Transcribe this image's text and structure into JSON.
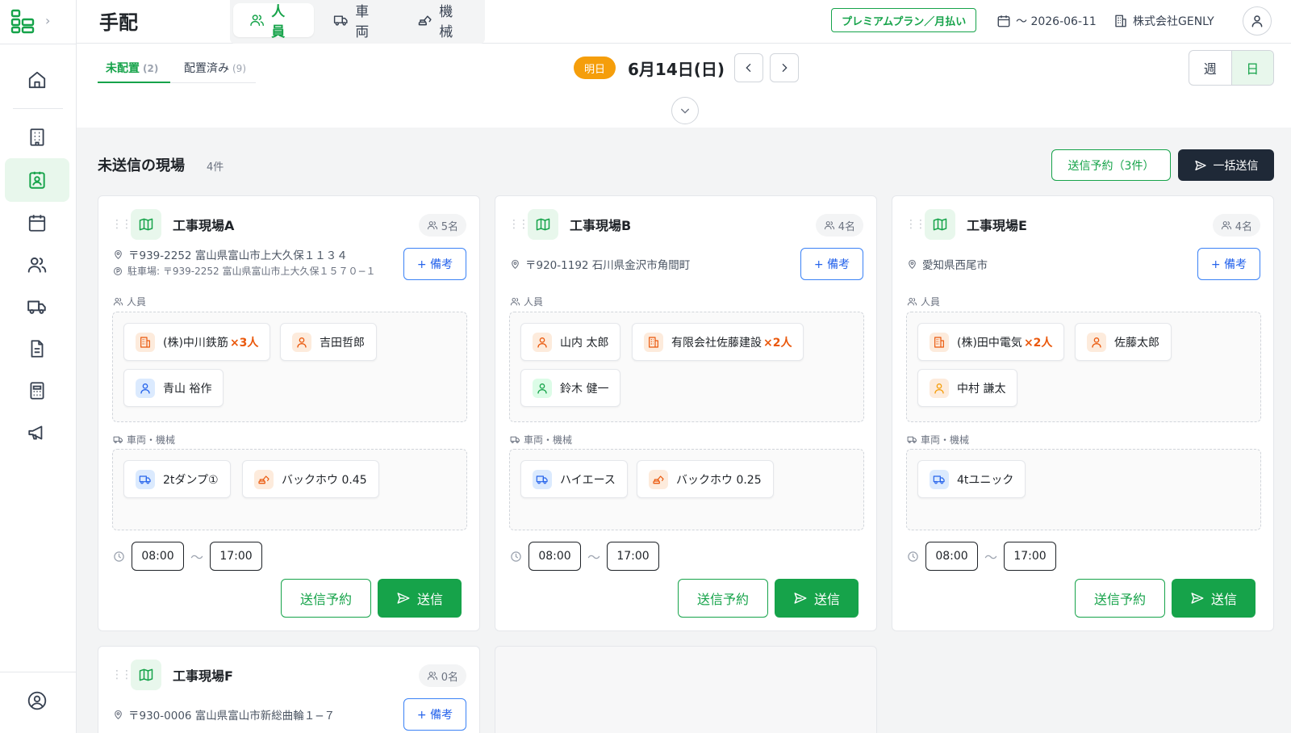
{
  "header": {
    "title": "手配",
    "tabs": [
      {
        "label": "人員"
      },
      {
        "label": "車両"
      },
      {
        "label": "機械"
      }
    ],
    "plan": "プレミアムプラン／月払い",
    "date_range": "〜 2026-06-11",
    "company": "株式会社GENLY"
  },
  "subbar": {
    "tab_unplaced": "未配置",
    "tab_unplaced_count": "(2)",
    "tab_placed": "配置済み",
    "tab_placed_count": "(9)",
    "tomorrow": "明日",
    "date": "6月14日(日)",
    "view_week": "週",
    "view_day": "日"
  },
  "section": {
    "title": "未送信の現場",
    "count": "4件",
    "schedule_all": "送信予約（3件）",
    "send_all": "一括送信"
  },
  "labels": {
    "people": "人員",
    "vehicles": "車両・機械",
    "memo": "+ 備考",
    "schedule": "送信予約",
    "send": "送信",
    "tilde": "〜"
  },
  "cards": [
    {
      "name": "工事現場A",
      "headcount": "5名",
      "address": "〒939-2252 富山県富山市上大久保１１３４",
      "parking": "駐車場: 〒939-2252 富山県富山市上大久保１５７０−１",
      "people": [
        {
          "name": "(株)中川鉄筋",
          "mult": "×3人"
        },
        {
          "name": "吉田哲郎"
        },
        {
          "name": "青山 裕作"
        }
      ],
      "vehicles": [
        {
          "name": "2tダンプ①"
        },
        {
          "name": "バックホウ 0.45"
        }
      ],
      "start": "08:00",
      "end": "17:00"
    },
    {
      "name": "工事現場B",
      "headcount": "4名",
      "address": "〒920-1192 石川県金沢市角間町",
      "people": [
        {
          "name": "山内 太郎"
        },
        {
          "name": "有限会社佐藤建設",
          "mult": "×2人"
        },
        {
          "name": "鈴木 健一"
        }
      ],
      "vehicles": [
        {
          "name": "ハイエース"
        },
        {
          "name": "バックホウ 0.25"
        }
      ],
      "start": "08:00",
      "end": "17:00"
    },
    {
      "name": "工事現場E",
      "headcount": "4名",
      "address": "愛知県西尾市",
      "people": [
        {
          "name": "(株)田中電気",
          "mult": "×2人"
        },
        {
          "name": "佐藤太郎"
        },
        {
          "name": "中村 謙太"
        }
      ],
      "vehicles": [
        {
          "name": "4tユニック"
        }
      ],
      "start": "08:00",
      "end": "17:00"
    },
    {
      "name": "工事現場F",
      "headcount": "0名",
      "address": "〒930-0006 富山県富山市新総曲輪１−７"
    }
  ],
  "colors": {
    "accent": "#16a34a",
    "orange": "#ea580c",
    "blue": "#2563eb",
    "dark": "#1f2937"
  }
}
